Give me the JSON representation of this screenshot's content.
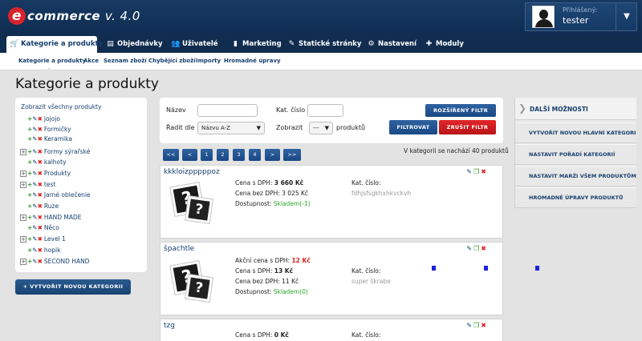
{
  "app": {
    "logo_letter": "e",
    "logo_text": "commerce",
    "logo_version": "v. 4.0"
  },
  "user": {
    "label": "Přihlášený:",
    "name": "tester",
    "caret": "▼"
  },
  "nav": {
    "tabs": [
      {
        "label": "Kategorie a produkty",
        "icon": "cart-icon"
      },
      {
        "label": "Objednávky",
        "icon": "list-icon"
      },
      {
        "label": "Uživatelé",
        "icon": "users-icon"
      },
      {
        "label": "Marketing",
        "icon": "bar-chart-icon"
      },
      {
        "label": "Statické stránky",
        "icon": "edit-icon"
      },
      {
        "label": "Nastavení",
        "icon": "gear-icon"
      },
      {
        "label": "Moduly",
        "icon": "puzzle-icon"
      }
    ]
  },
  "subnav": [
    "Kategorie a produkty",
    "Akce",
    "Seznam zboží",
    "Chybějící zboží",
    "Importy",
    "Hromadné úpravy"
  ],
  "page_title": "Kategorie a produkty",
  "categories": {
    "show_all": "Zobrazit všechny produkty",
    "items": [
      {
        "name": "jojojo",
        "expandable": false
      },
      {
        "name": "Formičky",
        "expandable": false
      },
      {
        "name": "Keramika",
        "expandable": false
      },
      {
        "name": "Formy sýrařské",
        "expandable": true
      },
      {
        "name": "kalhoty",
        "expandable": false
      },
      {
        "name": "Produkty",
        "expandable": true
      },
      {
        "name": "test",
        "expandable": true
      },
      {
        "name": "Jarné oblečenie",
        "expandable": false
      },
      {
        "name": "Ruze",
        "expandable": false
      },
      {
        "name": "HAND MADE",
        "expandable": true
      },
      {
        "name": "Něco",
        "expandable": false
      },
      {
        "name": "Level 1",
        "expandable": true
      },
      {
        "name": "hopik",
        "expandable": false
      },
      {
        "name": "SECOND HAND",
        "expandable": true
      }
    ],
    "new_button": "+ VYTVOŘIT NOVOU KATEGORII"
  },
  "filter": {
    "name_label": "Název",
    "code_label": "Kat. číslo",
    "sort_label": "Řadit dle",
    "sort_value": "Názvu A-Z",
    "show_label": "Zobrazit",
    "show_value": "---",
    "show_suffix": "produktů",
    "extended_button": "ROZŠÍŘENÝ FILTR",
    "filter_button": "FILTROVAT",
    "cancel_button": "ZRUŠIT FILTR"
  },
  "pagination": {
    "buttons": [
      "<<",
      "<",
      "1",
      "2",
      "3",
      "4",
      ">",
      ">>"
    ],
    "count_text": "V kategorii se nachází 40 produktů"
  },
  "products": [
    {
      "title": "kkkloizpppppoz",
      "price_vat_label": "Cena s DPH:",
      "price_vat": "3 660 Kč",
      "price_novat_label": "Cena bez DPH:",
      "price_novat": "3 025 Kč",
      "availability_label": "Dostupnost:",
      "availability": "Skladem(-1)",
      "code_label": "Kat. číslo:",
      "code": "fdhjsfsgkhxhkvckvh"
    },
    {
      "title": "špachtle",
      "action_price_label": "Akční cena s DPH:",
      "action_price": "12 Kč",
      "price_vat_label": "Cena s DPH:",
      "price_vat": "13 Kč",
      "price_novat_label": "Cena bez DPH:",
      "price_novat": "11 Kč",
      "availability_label": "Dostupnost:",
      "availability": "Skladem(0)",
      "code_label": "Kat. číslo:",
      "code": "super škrabe"
    },
    {
      "title": "tzg",
      "price_vat_label": "Cena s DPH:",
      "price_vat": "0 Kč",
      "code_label": "Kat. číslo:"
    }
  ],
  "more_options": {
    "title": "DALŠÍ MOŽNOSTI",
    "items": [
      "VYTVOŘIT NOVOU HLAVNÍ KATEGORII",
      "NASTAVIT POŘADÍ KATEGORIÍ",
      "NASTAVIT MARŽI VŠEM PRODUKTŮM",
      "HROMADNÉ ÚPRAVY PRODUKTŮ"
    ]
  },
  "colors": {
    "header": "#173a63",
    "nav": "#102d50",
    "accent_blue": "#1a4884",
    "accent_red": "#d22",
    "link": "#16406f",
    "stock_green": "#2aa52a"
  }
}
